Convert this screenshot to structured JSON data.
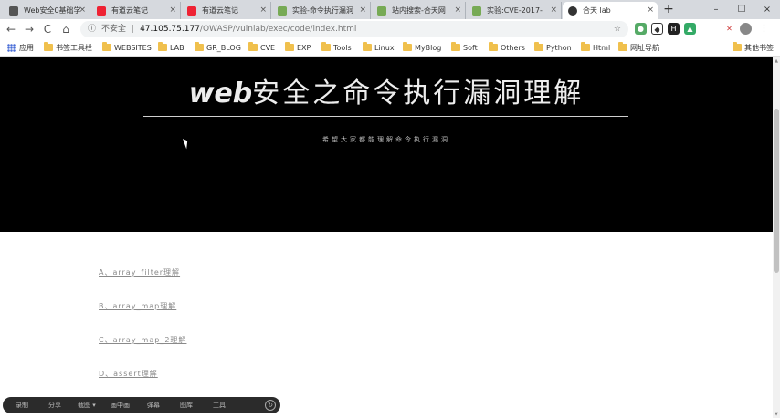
{
  "tabs": [
    {
      "label": "Web安全0基础学",
      "color": "#555"
    },
    {
      "label": "有道云笔记",
      "color": "#e23"
    },
    {
      "label": "有道云笔记",
      "color": "#e23"
    },
    {
      "label": "实验-命令执行漏洞",
      "color": "#7a5"
    },
    {
      "label": "站内搜索-合天网",
      "color": "#7a5"
    },
    {
      "label": "实验:CVE-2017-",
      "color": "#7a5"
    },
    {
      "label": "合天 lab",
      "color": "#333",
      "active": true
    }
  ],
  "toolbar": {
    "back": "←",
    "forward": "→",
    "reload": "C",
    "home": "⌂",
    "secure_label": "不安全",
    "url_host": "47.105.75.177",
    "url_path": "/OWASP/vulnlab/exec/code/index.html",
    "star": "☆"
  },
  "bookmarks": [
    {
      "label": "应用",
      "type": "apps"
    },
    {
      "label": "书签工具栏"
    },
    {
      "label": "WEBSITES"
    },
    {
      "label": "LAB"
    },
    {
      "label": "GR_BLOG"
    },
    {
      "label": "CVE"
    },
    {
      "label": "EXP"
    },
    {
      "label": "Tools"
    },
    {
      "label": "Linux"
    },
    {
      "label": "MyBlog"
    },
    {
      "label": "Soft"
    },
    {
      "label": "Others"
    },
    {
      "label": "Python"
    },
    {
      "label": "Html"
    },
    {
      "label": "网址导航"
    },
    {
      "label": "其他书签"
    }
  ],
  "hero": {
    "title_web": "web",
    "title_rest": "安全之命令执行漏洞理解",
    "subtitle": "希望大家都能理解命令执行漏洞"
  },
  "links": [
    "A、array_filter理解",
    "B、array_map理解",
    "C、array_map_2理解",
    "D、assert理解"
  ],
  "floatbar": [
    "录制",
    "分享",
    "截图 ▾",
    "画中画",
    "弹幕",
    "图库",
    "工具"
  ]
}
